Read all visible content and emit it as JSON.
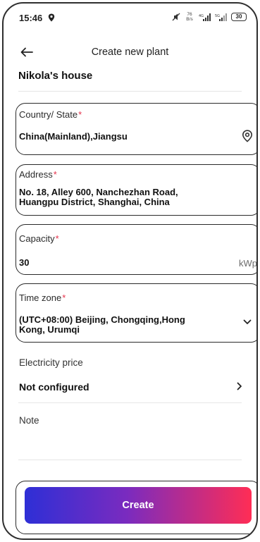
{
  "status_bar": {
    "time": "15:46",
    "network_speed": "76 B/s",
    "battery": "30",
    "icons": [
      "location-icon",
      "mute-icon",
      "signal-4g-icon",
      "signal-5g-icon",
      "battery-icon"
    ]
  },
  "header": {
    "back_icon": "arrow-left-icon",
    "title": "Create new plant"
  },
  "plant": {
    "name": "Nikola's house"
  },
  "form": {
    "country": {
      "label": "Country/ State",
      "required_mark": "*",
      "value": "China(Mainland),Jiangsu",
      "icon": "location-pin-icon"
    },
    "address": {
      "label": "Address",
      "required_mark": "*",
      "line1": "No. 18, Alley 600, Nanchezhan Road,",
      "line2": "Huangpu District, Shanghai, China"
    },
    "capacity": {
      "label": "Capacity",
      "required_mark": "*",
      "value": "30",
      "unit": "kWp"
    },
    "timezone": {
      "label": "Time zone",
      "required_mark": "*",
      "line1": "(UTC+08:00) Beijing, Chongqing,Hong",
      "line2": "Kong, Urumqi",
      "icon": "chevron-down-icon"
    },
    "electricity_price": {
      "label": "Electricity price",
      "value": "Not configured",
      "icon": "chevron-right-icon"
    },
    "note": {
      "label": "Note",
      "value": ""
    }
  },
  "actions": {
    "create_label": "Create"
  },
  "colors": {
    "required": "#e5324b",
    "button_gradient_start": "#2e2fd6",
    "button_gradient_end": "#ff2d55"
  }
}
